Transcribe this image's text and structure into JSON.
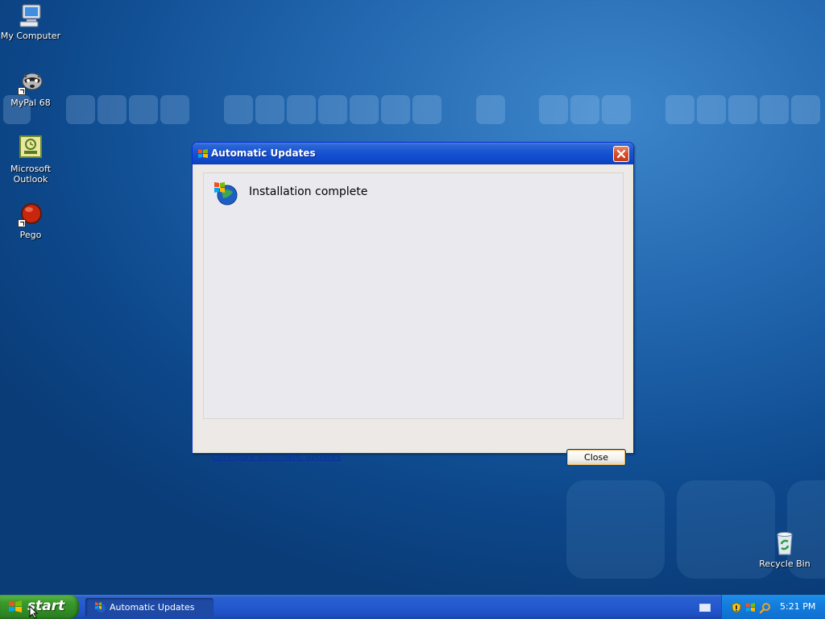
{
  "desktop": {
    "icons": [
      {
        "label": "My Computer",
        "icon": "my-computer-icon"
      },
      {
        "label": "MyPal 68",
        "icon": "raccoon-browser-icon"
      },
      {
        "label": "Microsoft Outlook",
        "icon": "outlook-icon"
      },
      {
        "label": "Pego",
        "icon": "red-ball-icon"
      },
      {
        "label": "Recycle Bin",
        "icon": "recycle-bin-icon"
      }
    ]
  },
  "dialog": {
    "title": "Automatic Updates",
    "title_icon": "windows-update-icon",
    "status": "Installation complete",
    "configure_link": "Configure automatic updates",
    "close_label": "Close"
  },
  "taskbar": {
    "start_label": "start",
    "task_label": "Automatic Updates",
    "tray_icons": [
      "keyboard-icon",
      "security-shield-icon",
      "windows-update-tray-icon",
      "search-icon"
    ],
    "clock": "5:21 PM"
  },
  "colors": {
    "title_blue": "#0a3fb8",
    "start_green": "#3c9a2d",
    "close_red": "#c23a1b",
    "link_blue": "#0b2f9f"
  }
}
